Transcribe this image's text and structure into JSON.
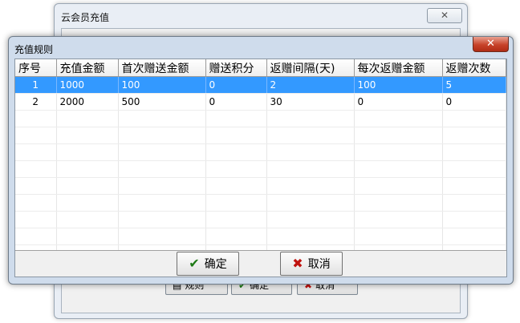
{
  "background_window": {
    "title": "云会员充值",
    "close_glyph": "✕",
    "buttons": {
      "rules": "规则",
      "ok": "确定",
      "cancel": "取消"
    }
  },
  "dialog": {
    "title": "充值规则",
    "close_glyph": "✕",
    "columns": [
      "序号",
      "充值金额",
      "首次赠送金额",
      "赠送积分",
      "返赠间隔(天)",
      "每次返赠金额",
      "返赠次数"
    ],
    "rows": [
      [
        "1",
        "1000",
        "100",
        "0",
        "2",
        "100",
        "5"
      ],
      [
        "2",
        "2000",
        "500",
        "0",
        "30",
        "0",
        "0"
      ]
    ],
    "buttons": {
      "ok": "确定",
      "cancel": "取消"
    }
  },
  "colors": {
    "selection": "#3399ff",
    "close_button": "#c7432a",
    "check_icon": "#1e7a16",
    "cross_icon": "#c0120e"
  },
  "icons": {
    "check": "✔",
    "cross": "✖"
  }
}
